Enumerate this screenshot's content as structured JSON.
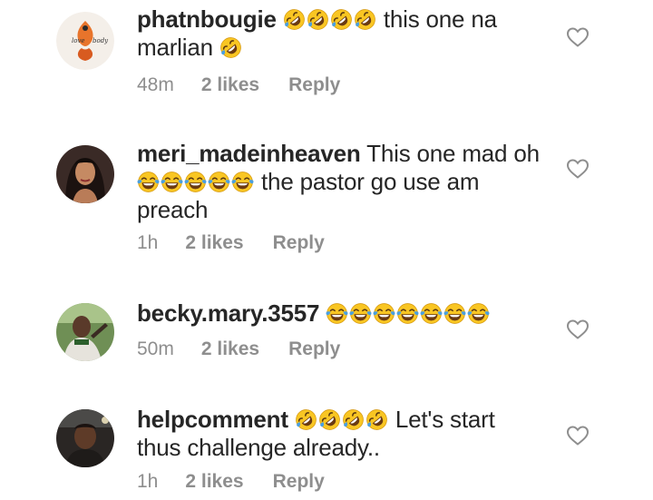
{
  "comments": [
    {
      "username": "phatnbougie",
      "pre_emojis": [
        "rofl-emoji",
        "rofl-emoji",
        "rofl-emoji",
        "rofl-emoji"
      ],
      "text": "this one na",
      "text2": "marlian",
      "post_emojis": [
        "rofl-emoji"
      ],
      "time": "48m",
      "likes": "2 likes",
      "reply": "Reply",
      "avatar_text": "love body"
    },
    {
      "username": "meri_madeinheaven",
      "text": "This one mad oh",
      "mid_emojis": [
        "joy-emoji",
        "joy-emoji",
        "joy-emoji",
        "joy-emoji",
        "joy-emoji"
      ],
      "text2": "the pastor go use am",
      "text3": "preach",
      "time": "1h",
      "likes": "2 likes",
      "reply": "Reply"
    },
    {
      "username": "becky.mary.3557",
      "post_emojis": [
        "joy-emoji",
        "joy-emoji",
        "joy-emoji",
        "joy-emoji",
        "joy-emoji",
        "joy-emoji",
        "joy-emoji"
      ],
      "time": "50m",
      "likes": "2 likes",
      "reply": "Reply"
    },
    {
      "username": "helpcomment",
      "pre_emojis": [
        "rofl-emoji",
        "rofl-emoji",
        "rofl-emoji",
        "rofl-emoji"
      ],
      "text": "Let's start",
      "text2": "thus challenge already..",
      "time": "1h",
      "likes": "2 likes",
      "reply": "Reply"
    }
  ],
  "icons": {
    "like": "heart-outline-icon"
  },
  "colors": {
    "text": "#262626",
    "meta": "#8e8e8e",
    "emoji_face": "#f9c623",
    "emoji_tear": "#4a9fe0"
  }
}
